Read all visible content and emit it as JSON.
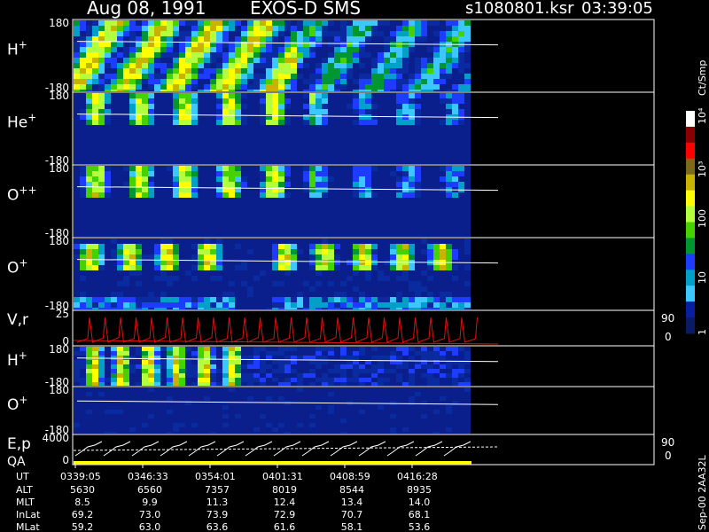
{
  "header": {
    "date": "Aug 08, 1991",
    "instrument": "EXOS-D SMS",
    "file": "s1080801.ksr",
    "time": "03:39:05"
  },
  "chart_data": {
    "type": "heatmap",
    "title": "Aug 08, 1991   EXOS-D SMS",
    "panels": [
      {
        "name": "H+",
        "base": "H",
        "sup": "+",
        "ymax_label": "180",
        "ymin_label": "-180",
        "ylim": [
          -180,
          180
        ]
      },
      {
        "name": "He+",
        "base": "He",
        "sup": "+",
        "ymax_label": "180",
        "ymin_label": "-180",
        "ylim": [
          -180,
          180
        ]
      },
      {
        "name": "O++",
        "base": "O",
        "sup": "++",
        "ymax_label": "180",
        "ymin_label": "-180",
        "ylim": [
          -180,
          180
        ]
      },
      {
        "name": "O+",
        "base": "O",
        "sup": "+",
        "ymax_label": "180",
        "ymin_label": "-180",
        "ylim": [
          -180,
          180
        ]
      },
      {
        "name": "V,r",
        "base": "V,r",
        "sup": "",
        "ymax_label": "25",
        "ymin_label": "0",
        "right_top": "90",
        "right_bottom": "0"
      },
      {
        "name": "H+ (2)",
        "base": "H",
        "sup": "+",
        "ymax_label": "180",
        "ymin_label": "-180",
        "ylim": [
          -180,
          180
        ]
      },
      {
        "name": "O+ (2)",
        "base": "O",
        "sup": "+",
        "ymax_label": "180",
        "ymin_label": "-180",
        "ylim": [
          -180,
          180
        ]
      },
      {
        "name": "E,p / QA",
        "base": "E,p",
        "line2": "QA",
        "sup": "",
        "ymax_label": "4000",
        "ymin_label": "0",
        "right_top": "90",
        "right_bottom": "0"
      }
    ],
    "colorbar": {
      "unit": "Ct/Smp",
      "ticks": [
        "10⁴",
        "10³",
        "100",
        "10",
        "1"
      ],
      "tick_values": [
        10000,
        1000,
        100,
        10,
        1
      ],
      "scale": "log",
      "colors": [
        "#ffffff",
        "#8b0000",
        "#ff0000",
        "#7a6a1a",
        "#c8b400",
        "#ffff00",
        "#b4ff3c",
        "#46d200",
        "#009632",
        "#1e3cff",
        "#00a0c8",
        "#3cc8ff",
        "#0a1ea0",
        "#0a1a64"
      ]
    },
    "x_axis": {
      "rows": [
        {
          "label": "UT",
          "values": [
            "0339:05",
            "0346:33",
            "0354:01",
            "0401:31",
            "0408:59",
            "0416:28"
          ]
        },
        {
          "label": "ALT",
          "values": [
            "5630",
            "6560",
            "7357",
            "8019",
            "8544",
            "8935"
          ]
        },
        {
          "label": "MLT",
          "values": [
            "8.5",
            "9.9",
            "11.3",
            "12.4",
            "13.4",
            "14.0"
          ]
        },
        {
          "label": "InLat",
          "values": [
            "69.2",
            "73.0",
            "73.9",
            "72.9",
            "70.7",
            "68.1"
          ]
        },
        {
          "label": "MLat",
          "values": [
            "59.2",
            "63.0",
            "63.6",
            "61.6",
            "58.1",
            "53.6"
          ]
        }
      ]
    },
    "side_note": "Sep-00  2AA32L"
  }
}
